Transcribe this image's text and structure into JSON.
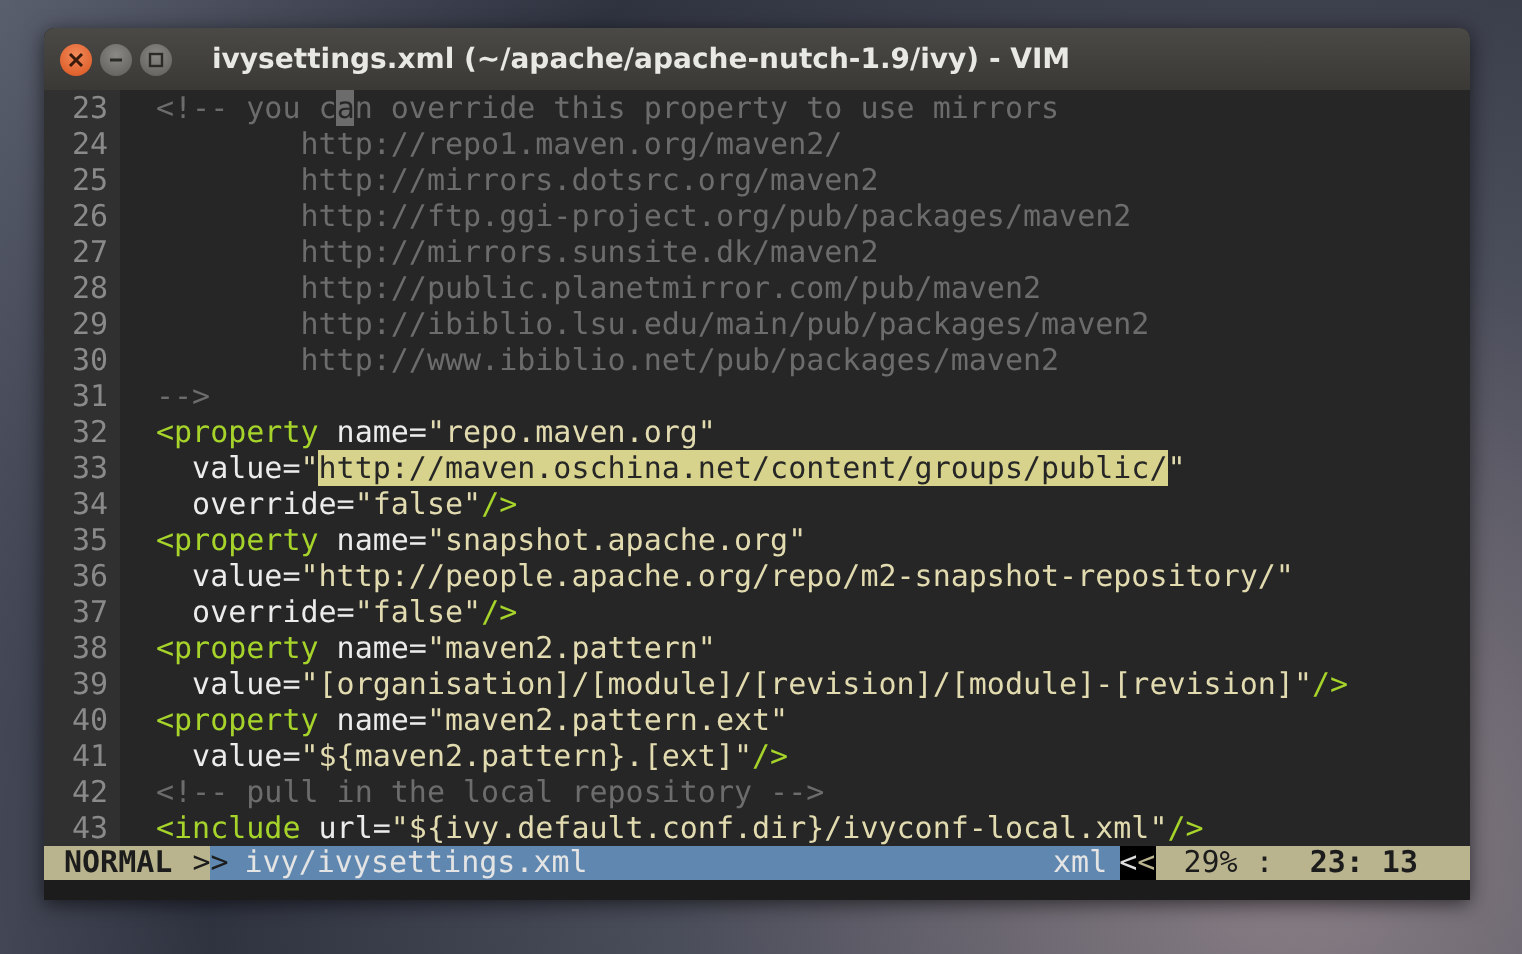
{
  "window": {
    "title": "ivysettings.xml (~/apache/apache-nutch-1.9/ivy) - VIM"
  },
  "editor": {
    "lines": [
      {
        "number": "23",
        "segments": [
          {
            "kind": "comment",
            "text": "<!-- you c"
          },
          {
            "kind": "cursor",
            "text": "a"
          },
          {
            "kind": "comment",
            "text": "n override this property to use mirrors"
          }
        ]
      },
      {
        "number": "24",
        "segments": [
          {
            "kind": "comment",
            "text": "        http://repo1.maven.org/maven2/"
          }
        ]
      },
      {
        "number": "25",
        "segments": [
          {
            "kind": "comment",
            "text": "        http://mirrors.dotsrc.org/maven2"
          }
        ]
      },
      {
        "number": "26",
        "segments": [
          {
            "kind": "comment",
            "text": "        http://ftp.ggi-project.org/pub/packages/maven2"
          }
        ]
      },
      {
        "number": "27",
        "segments": [
          {
            "kind": "comment",
            "text": "        http://mirrors.sunsite.dk/maven2"
          }
        ]
      },
      {
        "number": "28",
        "segments": [
          {
            "kind": "comment",
            "text": "        http://public.planetmirror.com/pub/maven2"
          }
        ]
      },
      {
        "number": "29",
        "segments": [
          {
            "kind": "comment",
            "text": "        http://ibiblio.lsu.edu/main/pub/packages/maven2"
          }
        ]
      },
      {
        "number": "30",
        "segments": [
          {
            "kind": "comment",
            "text": "        http://www.ibiblio.net/pub/packages/maven2"
          }
        ]
      },
      {
        "number": "31",
        "segments": [
          {
            "kind": "comment",
            "text": "-->"
          }
        ]
      },
      {
        "number": "32",
        "segments": [
          {
            "kind": "tag",
            "text": "<property"
          },
          {
            "kind": "attr",
            "text": " name="
          },
          {
            "kind": "string",
            "text": "\"repo.maven.org\""
          }
        ]
      },
      {
        "number": "33",
        "segments": [
          {
            "kind": "attr",
            "text": "  value="
          },
          {
            "kind": "string",
            "text": "\""
          },
          {
            "kind": "highlight",
            "text": "http://maven.oschina.net/content/groups/public/"
          },
          {
            "kind": "string",
            "text": "\""
          }
        ]
      },
      {
        "number": "34",
        "segments": [
          {
            "kind": "attr",
            "text": "  override="
          },
          {
            "kind": "string",
            "text": "\"false\""
          },
          {
            "kind": "tag",
            "text": "/>"
          }
        ]
      },
      {
        "number": "35",
        "segments": [
          {
            "kind": "tag",
            "text": "<property"
          },
          {
            "kind": "attr",
            "text": " name="
          },
          {
            "kind": "string",
            "text": "\"snapshot.apache.org\""
          }
        ]
      },
      {
        "number": "36",
        "segments": [
          {
            "kind": "attr",
            "text": "  value="
          },
          {
            "kind": "string",
            "text": "\"http://people.apache.org/repo/m2-snapshot-repository/\""
          }
        ]
      },
      {
        "number": "37",
        "segments": [
          {
            "kind": "attr",
            "text": "  override="
          },
          {
            "kind": "string",
            "text": "\"false\""
          },
          {
            "kind": "tag",
            "text": "/>"
          }
        ]
      },
      {
        "number": "38",
        "segments": [
          {
            "kind": "tag",
            "text": "<property"
          },
          {
            "kind": "attr",
            "text": " name="
          },
          {
            "kind": "string",
            "text": "\"maven2.pattern\""
          }
        ]
      },
      {
        "number": "39",
        "segments": [
          {
            "kind": "attr",
            "text": "  value="
          },
          {
            "kind": "string",
            "text": "\"[organisation]/[module]/[revision]/[module]-[revision]\""
          },
          {
            "kind": "tag",
            "text": "/>"
          }
        ]
      },
      {
        "number": "40",
        "segments": [
          {
            "kind": "tag",
            "text": "<property"
          },
          {
            "kind": "attr",
            "text": " name="
          },
          {
            "kind": "string",
            "text": "\"maven2.pattern.ext\""
          }
        ]
      },
      {
        "number": "41",
        "segments": [
          {
            "kind": "attr",
            "text": "  value="
          },
          {
            "kind": "string",
            "text": "\"${maven2.pattern}.[ext]\""
          },
          {
            "kind": "tag",
            "text": "/>"
          }
        ]
      },
      {
        "number": "42",
        "segments": [
          {
            "kind": "comment",
            "text": "<!-- pull in the local repository -->"
          }
        ]
      },
      {
        "number": "43",
        "segments": [
          {
            "kind": "tag",
            "text": "<include"
          },
          {
            "kind": "attr",
            "text": " url="
          },
          {
            "kind": "string",
            "text": "\"${ivy.default.conf.dir}/ivyconf-local.xml\""
          },
          {
            "kind": "tag",
            "text": "/>"
          }
        ]
      }
    ]
  },
  "status_bar": {
    "mode": "NORMAL",
    "left_separators": [
      ">",
      ">"
    ],
    "file": "ivy/ivysettings.xml",
    "filetype": "xml",
    "right_separators": [
      "<",
      "<"
    ],
    "percent": "29%",
    "colon": ":",
    "position": "23: 13"
  }
}
